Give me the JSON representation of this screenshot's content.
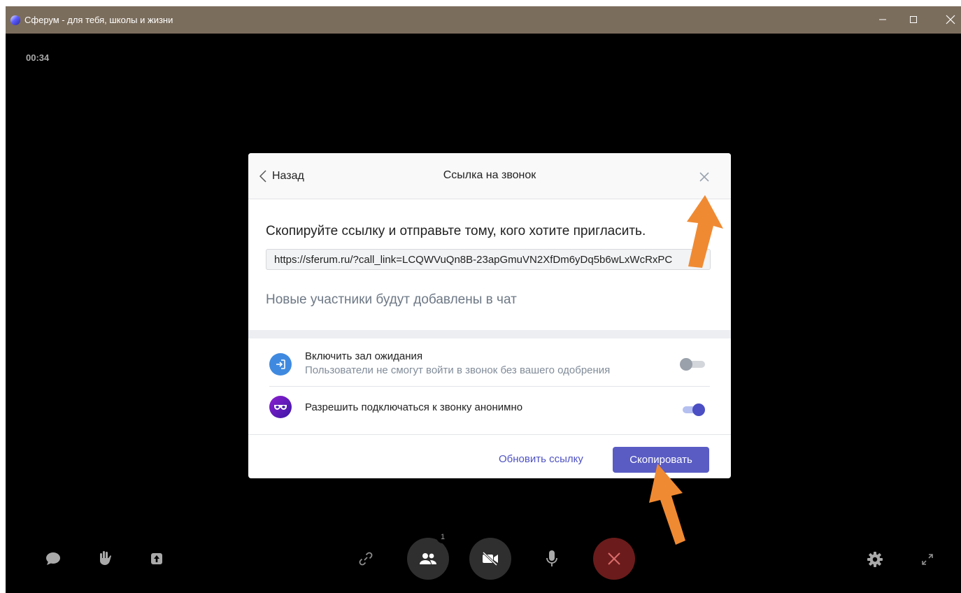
{
  "window": {
    "title": "Сферум - для тебя, школы и жизни",
    "minimize_symbol": "—",
    "close_symbol": "✕"
  },
  "call": {
    "timer": "00:34"
  },
  "modal": {
    "back_label": "Назад",
    "title": "Ссылка на звонок",
    "instruction": "Скопируйте ссылку и отправьте тому, кого хотите пригласить.",
    "link_value": "https://sferum.ru/?call_link=LCQWVuQn8B-23apGmuVN2XfDm6yDq5b6wLxWcRxPC",
    "info": "Новые участники будут добавлены в чат",
    "options": [
      {
        "title": "Включить зал ожидания",
        "subtitle": "Пользователи не смогут войти в звонок без вашего одобрения",
        "enabled": false,
        "icon": "enter-icon"
      },
      {
        "title": "Разрешить подключаться к звонку анонимно",
        "enabled": true,
        "icon": "anonymous-mask-icon"
      }
    ],
    "refresh_label": "Обновить ссылку",
    "copy_label": "Скопировать"
  },
  "controls": {
    "participants_count": "1",
    "icons": [
      "chat-icon",
      "raise-hand-icon",
      "share-screen-icon",
      "link-icon",
      "participants-icon",
      "camera-off-icon",
      "microphone-icon",
      "end-call-icon",
      "settings-icon",
      "fullscreen-icon"
    ]
  },
  "colors": {
    "titlebar": "#7b6d5c",
    "accent": "#5a5cc4",
    "end_call": "#6b1b1b",
    "annotation_arrow": "#f08a32"
  }
}
